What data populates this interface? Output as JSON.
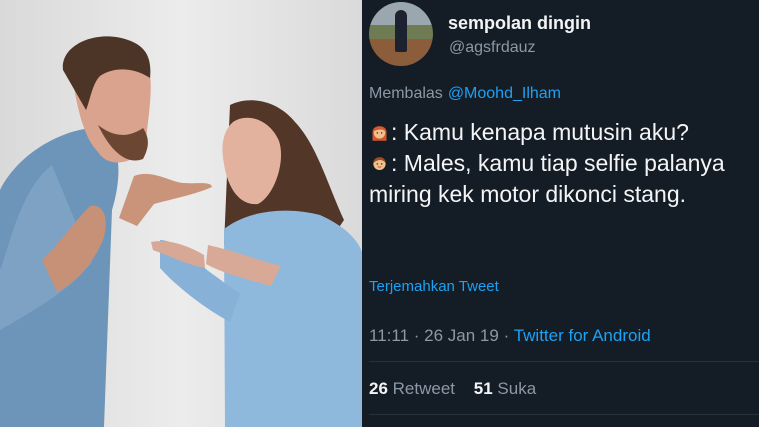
{
  "photo": {
    "alt": ""
  },
  "tweet": {
    "display_name": "sempolan dingin",
    "handle": "@agsfrdauz",
    "reply_prefix": "Membalas",
    "reply_mention": "@Moohd_Ilham",
    "line1": ": Kamu kenapa mutusin aku?",
    "line2": ": Males, kamu tiap selfie palanya miring kek motor dikonci stang.",
    "translate": "Terjemahkan Tweet",
    "time": "11:11",
    "date": "26 Jan 19",
    "client": "Twitter for Android",
    "separator": "·",
    "retweet_count": "26",
    "retweet_label": "Retweet",
    "like_count": "51",
    "like_label": "Suka",
    "icons": {
      "woman": "woman-emoji-icon",
      "man": "man-emoji-icon"
    },
    "colors": {
      "background": "#141d26",
      "link": "#1da1f2",
      "muted": "#8b98a5"
    }
  }
}
